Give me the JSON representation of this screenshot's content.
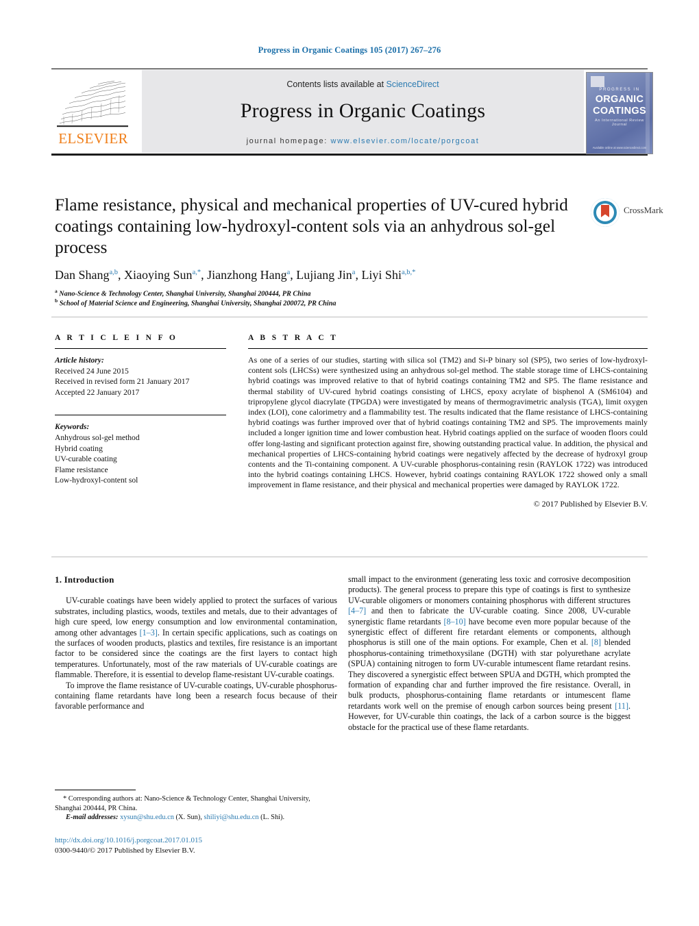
{
  "running_head": "Progress in Organic Coatings 105 (2017) 267–276",
  "masthead": {
    "contents_prefix": "Contents lists available at ",
    "contents_link": "ScienceDirect",
    "journal_name": "Progress in Organic Coatings",
    "homepage_prefix": "journal homepage: ",
    "homepage_url": "www.elsevier.com/locate/porgcoat",
    "publisher_wordmark": "ELSEVIER"
  },
  "cover": {
    "band": "PROGRESS IN",
    "title_line1": "ORGANIC",
    "title_line2": "COATINGS",
    "subtitle": "An International Review Journal",
    "footer": "Available online at www.sciencedirect.com"
  },
  "crossmark": {
    "label": "CrossMark"
  },
  "article": {
    "title": "Flame resistance, physical and mechanical properties of UV-cured hybrid coatings containing low-hydroxyl-content sols via an anhydrous sol-gel process",
    "authors_html": "Dan Shang<sup>a,b</sup>, Xiaoying Sun<sup>a,</sup><sup>*</sup>, Jianzhong Hang<sup>a</sup>, Lujiang Jin<sup>a</sup>, Liyi Shi<sup>a,b,</sup><sup>*</sup>",
    "affiliation_a": "Nano-Science & Technology Center, Shanghai University, Shanghai 200444, PR China",
    "affiliation_b": "School of Material Science and Engineering, Shanghai University, Shanghai 200072, PR China"
  },
  "article_info": {
    "heading": "A R T I C L E   I N F O",
    "history_label": "Article history:",
    "history": [
      "Received 24 June 2015",
      "Received in revised form 21 January 2017",
      "Accepted 22 January 2017"
    ],
    "keywords_label": "Keywords:",
    "keywords": [
      "Anhydrous sol-gel method",
      "Hybrid coating",
      "UV-curable coating",
      "Flame resistance",
      "Low-hydroxyl-content sol"
    ]
  },
  "abstract": {
    "heading": "A B S T R A C T",
    "text": "As one of a series of our studies, starting with silica sol (TM2) and Si-P binary sol (SP5), two series of low-hydroxyl-content sols (LHCSs) were synthesized using an anhydrous sol-gel method. The stable storage time of LHCS-containing hybrid coatings was improved relative to that of hybrid coatings containing TM2 and SP5. The flame resistance and thermal stability of UV-cured hybrid coatings consisting of LHCS, epoxy acrylate of bisphenol A (SM6104) and tripropylene glycol diacrylate (TPGDA) were investigated by means of thermogravimetric analysis (TGA), limit oxygen index (LOI), cone calorimetry and a flammability test. The results indicated that the flame resistance of LHCS-containing hybrid coatings was further improved over that of hybrid coatings containing TM2 and SP5. The improvements mainly included a longer ignition time and lower combustion heat. Hybrid coatings applied on the surface of wooden floors could offer long-lasting and significant protection against fire, showing outstanding practical value. In addition, the physical and mechanical properties of LHCS-containing hybrid coatings were negatively affected by the decrease of hydroxyl group contents and the Ti-containing component. A UV-curable phosphorus-containing resin (RAYLOK 1722) was introduced into the hybrid coatings containing LHCS. However, hybrid coatings containing RAYLOK 1722 showed only a small improvement in flame resistance, and their physical and mechanical properties were damaged by RAYLOK 1722.",
    "copyright": "© 2017 Published by Elsevier B.V."
  },
  "body": {
    "section_heading": "1.  Introduction",
    "left_paragraph_1_a": "UV-curable coatings have been widely applied to protect the surfaces of various substrates, including plastics, woods, textiles and metals, due to their advantages of high cure speed, low energy consumption and low environmental contamination, among other advantages ",
    "left_ref_1": "[1–3]",
    "left_paragraph_1_b": ". In certain specific applications, such as coatings on the surfaces of wooden products, plastics and textiles, fire resistance is an important factor to be considered since the coatings are the first layers to contact high temperatures. Unfortunately, most of the raw materials of UV-curable coatings are flammable. Therefore, it is essential to develop flame-resistant UV-curable coatings.",
    "left_paragraph_2": "To improve the flame resistance of UV-curable coatings, UV-curable phosphorus-containing flame retardants have long been a research focus because of their favorable performance and",
    "right_paragraph_a": "small impact to the environment (generating less toxic and corrosive decomposition products). The general process to prepare this type of coatings is first to synthesize UV-curable oligomers or monomers containing phosphorus with different structures ",
    "right_ref_1": "[4–7]",
    "right_paragraph_b": " and then to fabricate the UV-curable coating. Since 2008, UV-curable synergistic flame retardants ",
    "right_ref_2": "[8–10]",
    "right_paragraph_c": " have become even more popular because of the synergistic effect of different fire retardant elements or components, although phosphorus is still one of the main options. For example, Chen et al. ",
    "right_ref_3": "[8]",
    "right_paragraph_d": " blended phosphorus-containing trimethoxysilane (DGTH) with star polyurethane acrylate (SPUA) containing nitrogen to form UV-curable intumescent flame retardant resins. They discovered a synergistic effect between SPUA and DGTH, which prompted the formation of expanding char and further improved the fire resistance. Overall, in bulk products, phosphorus-containing flame retardants or intumescent flame retardants work well on the premise of enough carbon sources being present ",
    "right_ref_4": "[11]",
    "right_paragraph_e": ". However, for UV-curable thin coatings, the lack of a carbon source is the biggest obstacle for the practical use of these flame retardants."
  },
  "footnotes": {
    "corresponding": "*  Corresponding authors at: Nano-Science & Technology Center, Shanghai University, Shanghai 200444, PR China.",
    "email_label": "E-mail addresses:",
    "email_1": "xysun@shu.edu.cn",
    "email_1_owner": "(X. Sun),",
    "email_2": "shiliyi@shu.edu.cn",
    "email_2_owner": "(L. Shi).",
    "doi": "http://dx.doi.org/10.1016/j.porgcoat.2017.01.015",
    "issn_line": "0300-9440/© 2017 Published by Elsevier B.V."
  },
  "colors": {
    "link": "#2a7ab0",
    "elsevier_orange": "#f07f1a",
    "crossmark_blue": "#2d8ab5"
  }
}
